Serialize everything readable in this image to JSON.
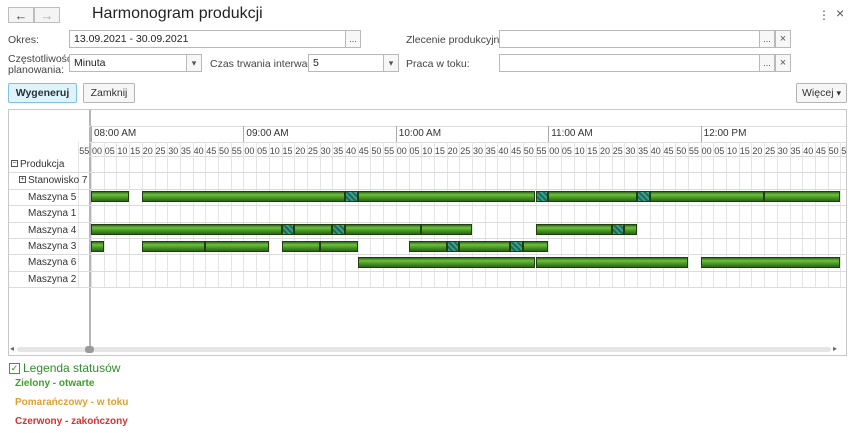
{
  "header": {
    "title": "Harmonogram produkcji",
    "back_icon": "←",
    "forward_icon": "→",
    "more_icon": "⋮",
    "close_icon": "×"
  },
  "filters": {
    "okres_label": "Okres:",
    "okres_value": "13.09.2021 - 30.09.2021",
    "czestotliwosc_label_1": "Częstotliwość",
    "czestotliwosc_label_2": "planowania:",
    "czestotliwosc_value": "Minuta",
    "czas_label": "Czas trwania interwału:",
    "czas_value": "5",
    "zlecenie_label": "Zlecenie produkcyjne:",
    "zlecenie_value": "",
    "praca_label": "Praca w toku:",
    "praca_value": "",
    "dots": "...",
    "clear": "×",
    "dropdown": "▾"
  },
  "buttons": {
    "generate": "Wygeneruj",
    "close": "Zamknij",
    "more": "Więcej",
    "more_arrow": "▾"
  },
  "gantt": {
    "hours": [
      "08:00 AM",
      "09:00 AM",
      "10:00 AM",
      "11:00 AM",
      "12:00 PM"
    ],
    "minute_labels": [
      "00",
      "05",
      "10",
      "15",
      "20",
      "25",
      "30",
      "35",
      "40",
      "45",
      "50",
      "55"
    ],
    "rows": [
      {
        "label": "Produkcja",
        "expander": "−"
      },
      {
        "label": "Stanowisko 7",
        "expander": "+"
      },
      {
        "label": "Maszyna 5"
      },
      {
        "label": "Maszyna 1"
      },
      {
        "label": "Maszyna 4"
      },
      {
        "label": "Maszyna 3"
      },
      {
        "label": "Maszyna 6"
      },
      {
        "label": "Maszyna 2"
      }
    ],
    "schedule_items": [
      {
        "row": 2,
        "start": "08:00",
        "end": "08:15",
        "state": "open"
      },
      {
        "row": 2,
        "start": "08:20",
        "end": "09:40",
        "state": "open"
      },
      {
        "row": 2,
        "start": "09:40",
        "end": "09:45",
        "state": "hatched"
      },
      {
        "row": 2,
        "start": "09:45",
        "end": "10:55",
        "state": "open"
      },
      {
        "row": 2,
        "start": "10:55",
        "end": "11:00",
        "state": "hatched"
      },
      {
        "row": 2,
        "start": "11:00",
        "end": "11:35",
        "state": "open"
      },
      {
        "row": 2,
        "start": "11:35",
        "end": "11:40",
        "state": "hatched"
      },
      {
        "row": 2,
        "start": "11:40",
        "end": "12:25",
        "state": "open"
      },
      {
        "row": 2,
        "start": "12:25",
        "end": "12:55",
        "state": "open"
      },
      {
        "row": 4,
        "start": "08:00",
        "end": "09:15",
        "state": "open"
      },
      {
        "row": 4,
        "start": "09:15",
        "end": "09:20",
        "state": "hatched"
      },
      {
        "row": 4,
        "start": "09:20",
        "end": "09:35",
        "state": "open"
      },
      {
        "row": 4,
        "start": "09:35",
        "end": "09:40",
        "state": "hatched"
      },
      {
        "row": 4,
        "start": "09:40",
        "end": "10:10",
        "state": "open"
      },
      {
        "row": 4,
        "start": "10:10",
        "end": "10:30",
        "state": "open"
      },
      {
        "row": 4,
        "start": "10:55",
        "end": "11:25",
        "state": "open"
      },
      {
        "row": 4,
        "start": "11:25",
        "end": "11:30",
        "state": "hatched"
      },
      {
        "row": 4,
        "start": "11:30",
        "end": "11:35",
        "state": "open"
      },
      {
        "row": 5,
        "start": "08:00",
        "end": "08:05",
        "state": "open"
      },
      {
        "row": 5,
        "start": "08:20",
        "end": "08:45",
        "state": "open"
      },
      {
        "row": 5,
        "start": "08:45",
        "end": "09:10",
        "state": "open"
      },
      {
        "row": 5,
        "start": "09:15",
        "end": "09:30",
        "state": "open"
      },
      {
        "row": 5,
        "start": "09:30",
        "end": "09:45",
        "state": "open"
      },
      {
        "row": 5,
        "start": "10:05",
        "end": "10:20",
        "state": "open"
      },
      {
        "row": 5,
        "start": "10:20",
        "end": "10:25",
        "state": "hatched"
      },
      {
        "row": 5,
        "start": "10:25",
        "end": "10:45",
        "state": "open"
      },
      {
        "row": 5,
        "start": "10:45",
        "end": "10:50",
        "state": "hatched"
      },
      {
        "row": 5,
        "start": "10:50",
        "end": "11:00",
        "state": "open"
      },
      {
        "row": 6,
        "start": "09:45",
        "end": "10:55",
        "state": "open"
      },
      {
        "row": 6,
        "start": "10:55",
        "end": "11:55",
        "state": "open"
      },
      {
        "row": 6,
        "start": "12:00",
        "end": "12:55",
        "state": "open"
      }
    ]
  },
  "legend": {
    "title": "Legenda statusów",
    "items": [
      {
        "text": "Zielony - otwarte",
        "color": "#3f9f2a"
      },
      {
        "text": "Pomarańczowy - w toku",
        "color": "#e0a030"
      },
      {
        "text": "Czerwony - zakończony",
        "color": "#d63030"
      }
    ],
    "checkbox": "✓"
  }
}
